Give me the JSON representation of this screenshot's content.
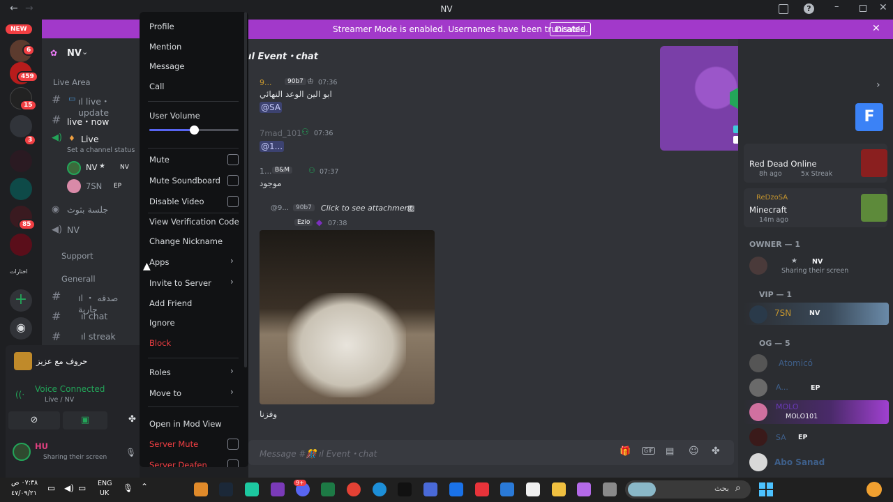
{
  "window": {
    "title": "NV"
  },
  "banner": {
    "text": "Streamer Mode is enabled. Usernames have been truncated.",
    "disable": "Disable"
  },
  "rail": {
    "new_badge": "NEW",
    "badges": [
      "6",
      "459",
      "15",
      "3",
      "85"
    ],
    "folder_label": "اختارات"
  },
  "server": {
    "name": "NV"
  },
  "sidebar": {
    "cat_live": "Live Area",
    "ch_update": "ıl live・update",
    "ch_now": "live・now",
    "voice_live": "Live",
    "voice_status": "Set a channel status",
    "user1": "NV",
    "user1_tag": "NV",
    "user2": "7SN",
    "user2_tag": "EP",
    "voice_arabic": "جلسة بثوث",
    "voice_nv": "NV",
    "cat_support": "Support",
    "cat_general": "Generall",
    "ch_charity": "ıl صدقه ・ جارية",
    "ch_chat": "ıl chat",
    "ch_streak": "ıl streak",
    "activity": "حروف مع عزيز",
    "voice_connected": "Voice Connected",
    "voice_path": "Live / NV",
    "me_name": "HU",
    "me_status": "Sharing their screen"
  },
  "chat": {
    "header": "ıl Event・chat",
    "messages": [
      {
        "author": "9...",
        "tag": "90b7",
        "time": "07:36",
        "text": "ابو الين الوعد النهائي",
        "mention": "@SA"
      },
      {
        "author": "7mad_101",
        "time": "07:36",
        "mention": "@1..."
      },
      {
        "author": "1...",
        "tag": "B&M",
        "time": "07:37",
        "text": "موجود"
      },
      {
        "reply_author": "@9...",
        "reply_tag": "90b7",
        "reply_text": "Click to see attachment",
        "tag": "Ezio",
        "time": "07:38",
        "caption": "وفزنا"
      }
    ],
    "input_placeholder": "Message #🎊 ıl Event・chat"
  },
  "members": {
    "activity1": {
      "game": "Red Dead Online",
      "meta": "8h ago",
      "streak": "5x Streak"
    },
    "activity2": {
      "user": "ReDzoSA",
      "game": "Minecraft",
      "meta": "14m ago"
    },
    "owner_header": "OWNER — 1",
    "owner": {
      "tag": "NV",
      "status": "Sharing their screen"
    },
    "vip_header": "VIP — 1",
    "vip": {
      "name": "7SN",
      "tag": "NV"
    },
    "og_header": "OG — 5",
    "og": [
      {
        "name": "Atomicó"
      },
      {
        "name": "A...",
        "tag": "EP"
      },
      {
        "name": "MOLO",
        "sub": "MOLO101"
      },
      {
        "name": "SA",
        "tag": "EP"
      },
      {
        "name": "Abo Sanad"
      }
    ]
  },
  "context_menu": {
    "profile": "Profile",
    "mention": "Mention",
    "message": "Message",
    "call": "Call",
    "user_volume": "User Volume",
    "volume_pct": 0.5,
    "mute": "Mute",
    "mute_soundboard": "Mute Soundboard",
    "disable_video": "Disable Video",
    "verification": "View Verification Code",
    "change_nickname": "Change Nickname",
    "apps": "Apps",
    "invite": "Invite to Server",
    "add_friend": "Add Friend",
    "ignore": "Ignore",
    "block": "Block",
    "roles": "Roles",
    "move_to": "Move to",
    "mod_view": "Open in Mod View",
    "server_mute": "Server Mute",
    "server_deafen": "Server Deafen"
  },
  "taskbar": {
    "time": "٠٧:٣٨ ص",
    "date": "٤٧/٠٩/٢١",
    "lang1": "ENG",
    "lang2": "UK",
    "search_placeholder": "بحث",
    "discord_badge": "9+"
  }
}
